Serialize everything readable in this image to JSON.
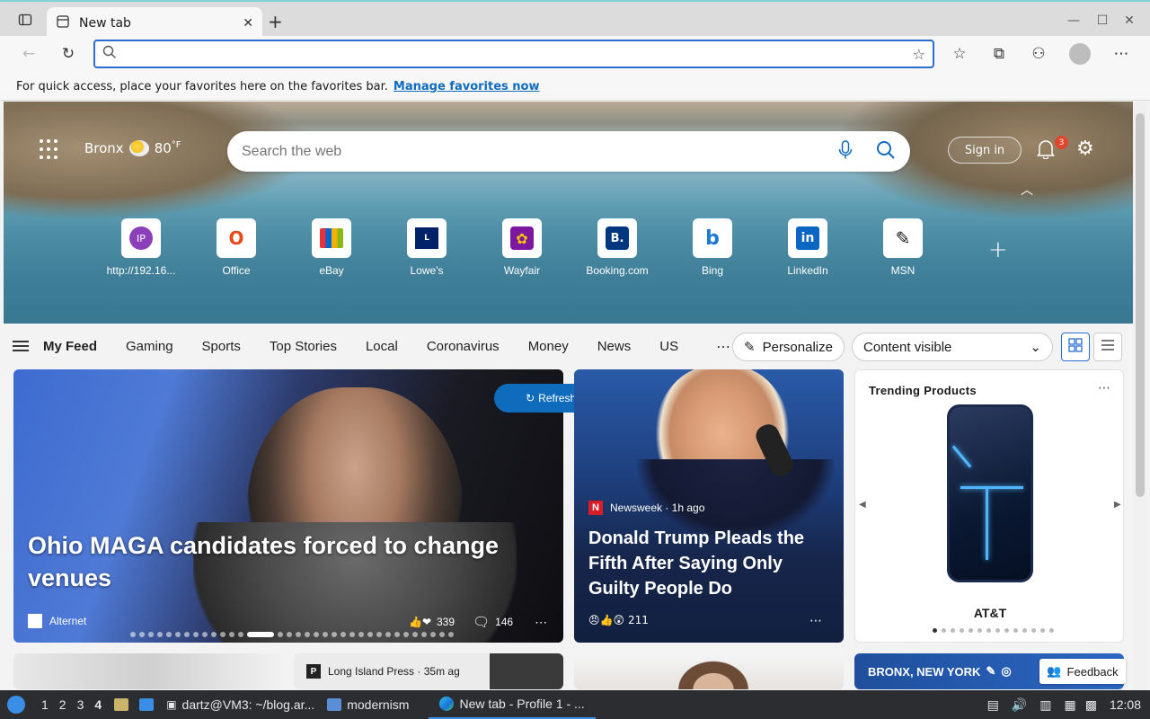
{
  "browser": {
    "tab_title": "New tab",
    "new_tab_symbol": "+",
    "address_value": "",
    "favbar_text": "For quick access, place your favorites here on the favorites bar.",
    "favbar_link": "Manage favorites now"
  },
  "hero": {
    "location": "Bronx",
    "temperature": "80",
    "temp_unit": "°F",
    "search_placeholder": "Search the web",
    "signin_label": "Sign in",
    "notification_count": "3",
    "tiles": [
      {
        "label": "http://192.16...",
        "icon_text": "IP"
      },
      {
        "label": "Office",
        "icon_text": "O"
      },
      {
        "label": "eBay",
        "icon_text": "▦"
      },
      {
        "label": "Lowe's",
        "icon_text": "L"
      },
      {
        "label": "Wayfair",
        "icon_text": "✿"
      },
      {
        "label": "Booking.com",
        "icon_text": "B."
      },
      {
        "label": "Bing",
        "icon_text": "b"
      },
      {
        "label": "LinkedIn",
        "icon_text": "in"
      },
      {
        "label": "MSN",
        "icon_text": "✎"
      }
    ]
  },
  "feednav": {
    "items": [
      "My Feed",
      "Gaming",
      "Sports",
      "Top Stories",
      "Local",
      "Coronavirus",
      "Money",
      "News",
      "US"
    ],
    "personalize_label": "Personalize",
    "content_visible_label": "Content visible"
  },
  "cards": {
    "refresh_label": "Refresh stories",
    "main": {
      "headline": "Ohio MAGA candidates forced to change venues",
      "source": "Alternet",
      "reactions": "339",
      "comments": "146"
    },
    "second": {
      "source": "Newsweek · 1h ago",
      "headline": "Donald Trump Pleads the Fifth After Saying Only Guilty People Do",
      "reactions": "211"
    },
    "trending": {
      "title": "Trending Products",
      "product": "AT&T"
    },
    "peek_press": "Long Island Press · 35m ag",
    "peek_weather": "BRONX, NEW YORK",
    "feedback_label": "Feedback"
  },
  "taskbar": {
    "workspaces": [
      "1",
      "2",
      "3",
      "4"
    ],
    "current_workspace": "4",
    "terminal": "dartz@VM3: ~/blog.ar...",
    "folder": "modernism",
    "browser": "New tab - Profile 1 - ...",
    "clock": "12:08"
  },
  "colors": {
    "accent": "#0f6cbd",
    "address_border": "#2b6ccf",
    "badge": "#e0462d",
    "taskbar": "#2b2d31"
  }
}
